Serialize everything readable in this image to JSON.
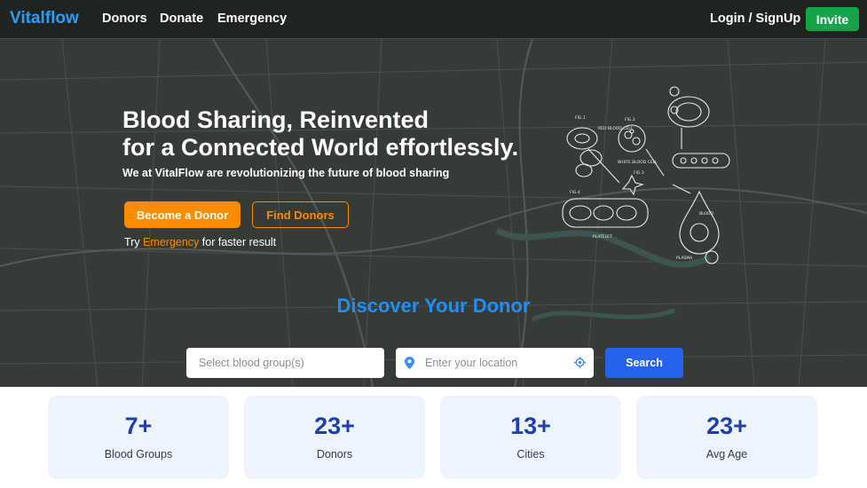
{
  "nav": {
    "brand": "Vitalflow",
    "links": [
      "Donors",
      "Donate",
      "Emergency"
    ],
    "login": "Login / SignUp",
    "invite": "Invite"
  },
  "hero": {
    "headline_1": "Blood Sharing, Reinvented",
    "headline_2": "for a Connected World effortlessly.",
    "subline": "We at VitalFlow are revolutionizing the future of blood sharing",
    "become_donor": "Become a Donor",
    "find_donors": "Find Donors",
    "try_prefix": "Try",
    "try_link": "Emergency",
    "try_suffix": "for faster result"
  },
  "illustration_labels": {
    "fig1": "FIG.1",
    "fig2": "FIG.2",
    "fig3": "FIG.3",
    "fig4": "FIG.4",
    "red_cell": "RED BLOOD CELL",
    "white_cell": "WHITE BLOOD CELL",
    "platelet": "PLATELET",
    "blood": "BLOOD",
    "plasma": "PLASMA"
  },
  "search": {
    "title": "Discover Your Donor",
    "blood_placeholder": "Select blood group(s)",
    "location_placeholder": "Enter your location",
    "button": "Search"
  },
  "stats": [
    {
      "value": "7+",
      "label": "Blood Groups"
    },
    {
      "value": "23+",
      "label": "Donors"
    },
    {
      "value": "13+",
      "label": "Cities"
    },
    {
      "value": "23+",
      "label": "Avg Age"
    }
  ],
  "colors": {
    "brand": "#2f9cf3",
    "accent_orange": "#fb8c00",
    "invite_green": "#16a34a",
    "search_blue": "#2563eb",
    "stat_value": "#1e3fb0",
    "stat_card_bg": "#eef4fd"
  }
}
